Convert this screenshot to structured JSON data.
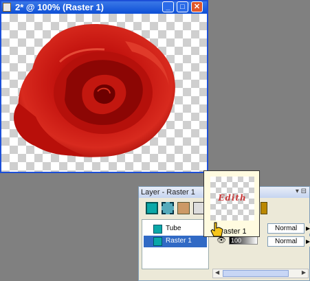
{
  "doc_window": {
    "title": "2* @ 100% (Raster 1)",
    "buttons": {
      "minimize": "_",
      "maximize": "□",
      "close": "✕"
    }
  },
  "layer_palette": {
    "title": "Layer - Raster 1",
    "layers": [
      {
        "name": "Tube",
        "blend": "Normal",
        "opacity": ""
      },
      {
        "name": "Raster 1",
        "blend": "Normal",
        "opacity": "100",
        "selected": true
      }
    ]
  },
  "thumbnail_popup": {
    "text": "Edith",
    "label": "aster 1"
  },
  "colors": {
    "title_bar": "#0d4fd6",
    "selection": "#316ac5",
    "rose": "#c0100e"
  }
}
